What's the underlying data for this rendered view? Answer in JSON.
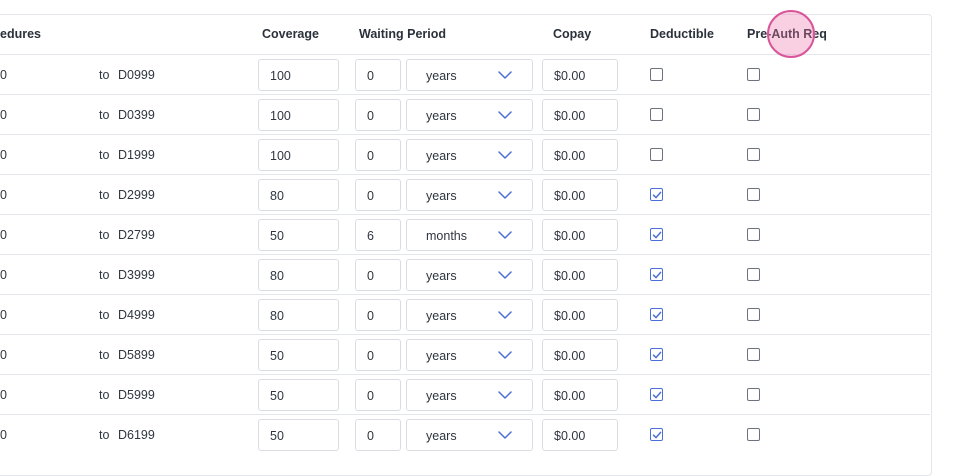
{
  "header": {
    "procedures": "edures",
    "coverage": "Coverage",
    "waiting_period": "Waiting Period",
    "copay": "Copay",
    "deductible": "Deductible",
    "pre_auth": "Pre-Auth Req"
  },
  "rows": [
    {
      "from": "0",
      "to_word": "to",
      "to_code": "D0999",
      "coverage": "100",
      "wait": "0",
      "unit": "years",
      "copay": "$0.00",
      "deductible": false,
      "preauth": false
    },
    {
      "from": "0",
      "to_word": "to",
      "to_code": "D0399",
      "coverage": "100",
      "wait": "0",
      "unit": "years",
      "copay": "$0.00",
      "deductible": false,
      "preauth": false
    },
    {
      "from": "0",
      "to_word": "to",
      "to_code": "D1999",
      "coverage": "100",
      "wait": "0",
      "unit": "years",
      "copay": "$0.00",
      "deductible": false,
      "preauth": false
    },
    {
      "from": "0",
      "to_word": "to",
      "to_code": "D2999",
      "coverage": "80",
      "wait": "0",
      "unit": "years",
      "copay": "$0.00",
      "deductible": true,
      "preauth": false
    },
    {
      "from": "0",
      "to_word": "to",
      "to_code": "D2799",
      "coverage": "50",
      "wait": "6",
      "unit": "months",
      "copay": "$0.00",
      "deductible": true,
      "preauth": false
    },
    {
      "from": "0",
      "to_word": "to",
      "to_code": "D3999",
      "coverage": "80",
      "wait": "0",
      "unit": "years",
      "copay": "$0.00",
      "deductible": true,
      "preauth": false
    },
    {
      "from": "0",
      "to_word": "to",
      "to_code": "D4999",
      "coverage": "80",
      "wait": "0",
      "unit": "years",
      "copay": "$0.00",
      "deductible": true,
      "preauth": false
    },
    {
      "from": "0",
      "to_word": "to",
      "to_code": "D5899",
      "coverage": "50",
      "wait": "0",
      "unit": "years",
      "copay": "$0.00",
      "deductible": true,
      "preauth": false
    },
    {
      "from": "0",
      "to_word": "to",
      "to_code": "D5999",
      "coverage": "50",
      "wait": "0",
      "unit": "years",
      "copay": "$0.00",
      "deductible": true,
      "preauth": false
    },
    {
      "from": "0",
      "to_word": "to",
      "to_code": "D6199",
      "coverage": "50",
      "wait": "0",
      "unit": "years",
      "copay": "$0.00",
      "deductible": true,
      "preauth": false
    }
  ],
  "colors": {
    "accent": "#4a6fd8",
    "border": "#e3e6ea",
    "cursor": "#d9559a"
  },
  "icons": {
    "dropdown": "chevron-down-icon",
    "checkbox": "checkbox-icon"
  }
}
